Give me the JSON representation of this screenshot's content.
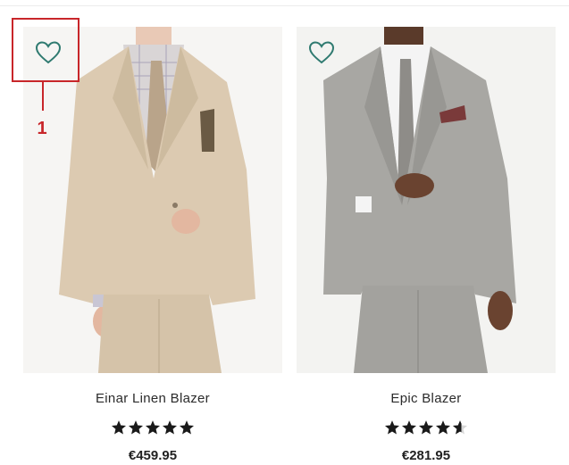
{
  "products": [
    {
      "name": "Einar Linen Blazer",
      "price": "€459.95",
      "rating": 5,
      "wishlist_icon": "heart-outline-icon",
      "accent": "#2f7a70",
      "jacket_color": "#d8c8b0",
      "tie_color": "#b8a48c"
    },
    {
      "name": "Epic Blazer",
      "price": "€281.95",
      "rating": 4.5,
      "wishlist_icon": "heart-outline-icon",
      "accent": "#2f7a70",
      "jacket_color": "#a7a6a2",
      "tie_color": "#8d8b87"
    }
  ],
  "annotation": {
    "label": "1",
    "color": "#c8262a"
  }
}
